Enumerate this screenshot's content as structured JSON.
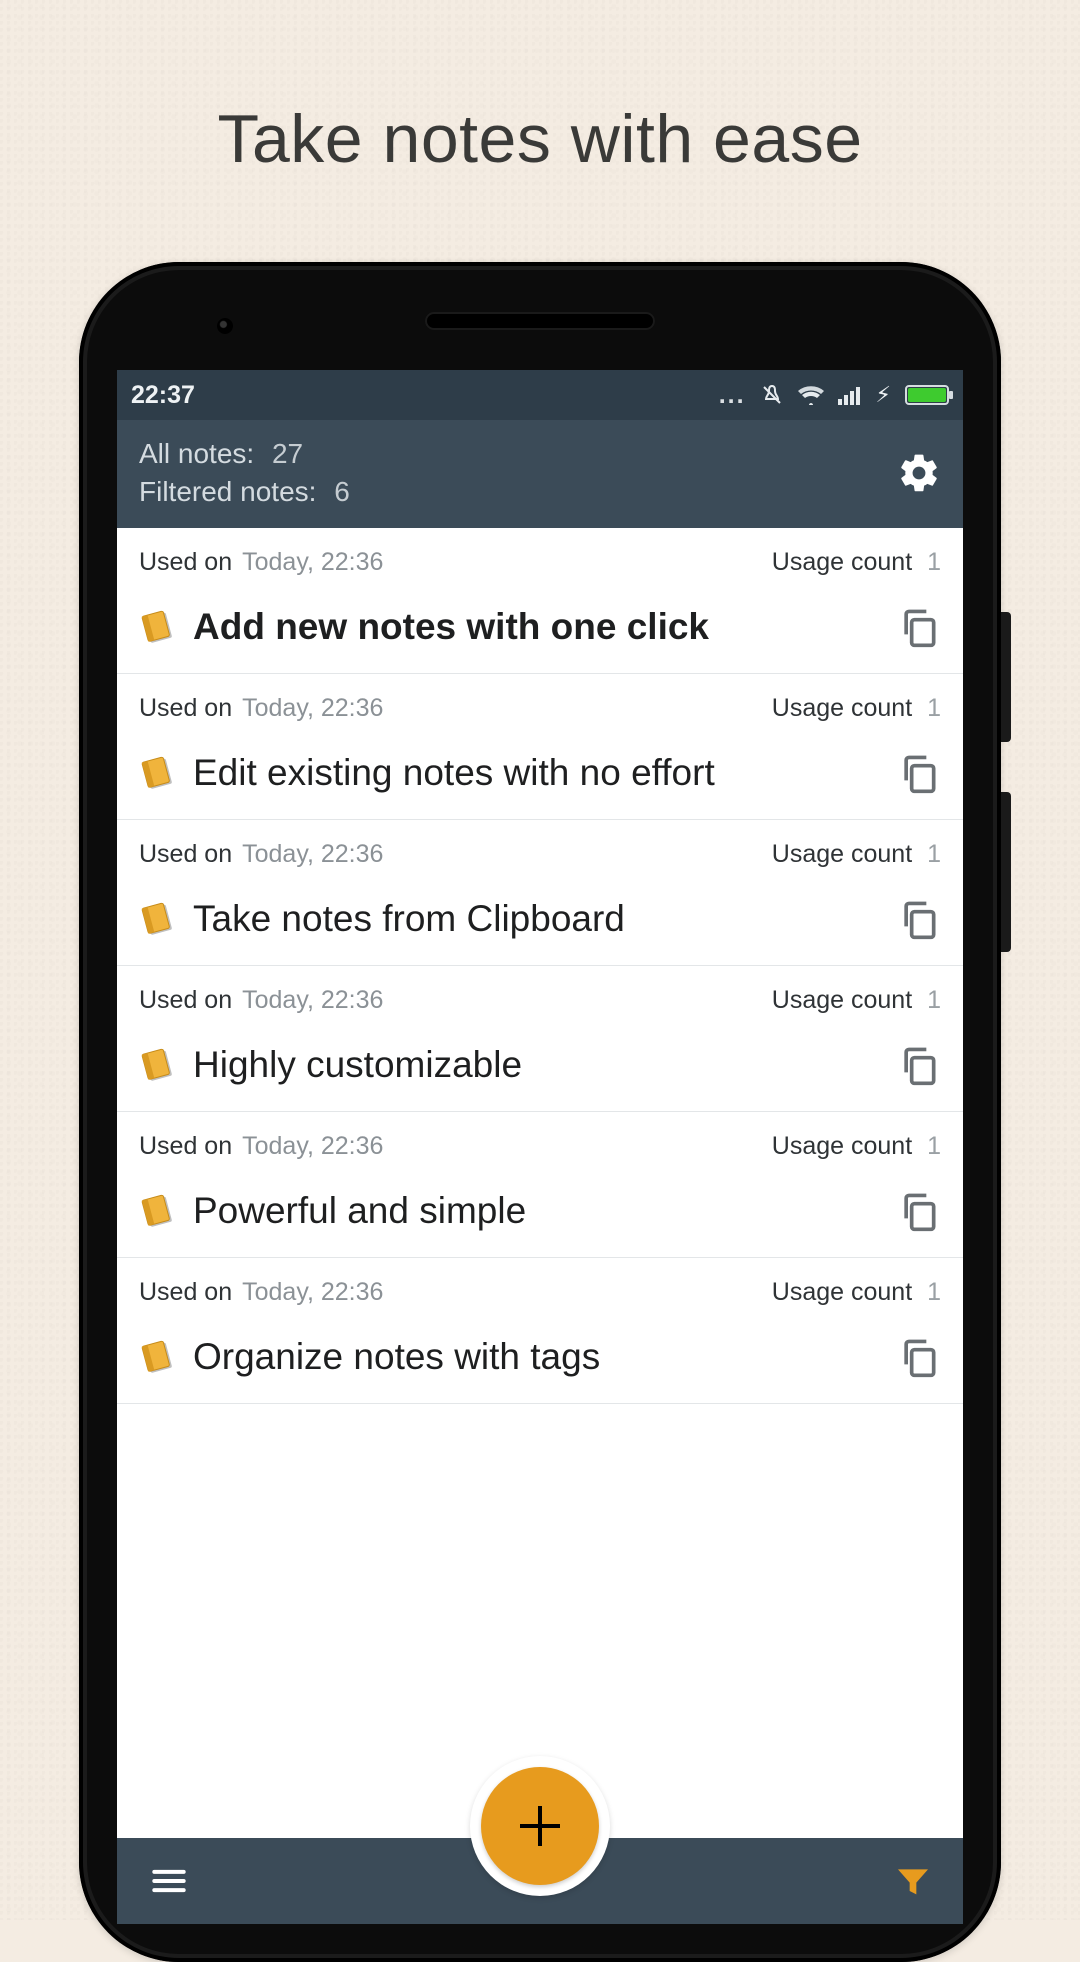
{
  "headline": "Take notes with ease",
  "statusbar": {
    "time": "22:37",
    "dots": "..."
  },
  "header": {
    "all_notes_label": "All notes:",
    "all_notes_count": "27",
    "filtered_notes_label": "Filtered notes:",
    "filtered_notes_count": "6"
  },
  "meta_labels": {
    "used_on": "Used on",
    "usage_count": "Usage count"
  },
  "notes": [
    {
      "title": "Add new notes with one click",
      "bold": true,
      "used_on_date": "Today, 22:36",
      "usage_count": "1"
    },
    {
      "title": "Edit existing notes with no effort",
      "bold": false,
      "used_on_date": "Today, 22:36",
      "usage_count": "1"
    },
    {
      "title": "Take notes from Clipboard",
      "bold": false,
      "used_on_date": "Today, 22:36",
      "usage_count": "1"
    },
    {
      "title": "Highly customizable",
      "bold": false,
      "used_on_date": "Today, 22:36",
      "usage_count": "1"
    },
    {
      "title": "Powerful and simple",
      "bold": false,
      "used_on_date": "Today, 22:36",
      "usage_count": "1"
    },
    {
      "title": "Organize notes with tags",
      "bold": false,
      "used_on_date": "Today, 22:36",
      "usage_count": "1"
    }
  ]
}
